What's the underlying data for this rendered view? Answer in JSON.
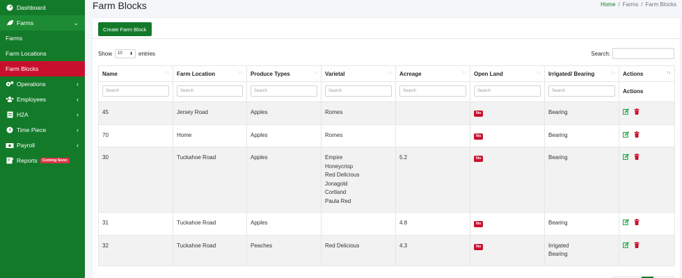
{
  "sidebar": {
    "items": [
      {
        "label": "Dashboard",
        "icon": "dashboard-icon"
      },
      {
        "label": "Farms",
        "icon": "leaf-icon"
      },
      {
        "label": "Farms"
      },
      {
        "label": "Farm Locations"
      },
      {
        "label": "Farm Blocks"
      },
      {
        "label": "Operations",
        "icon": "cogs-icon"
      },
      {
        "label": "Employees",
        "icon": "users-icon"
      },
      {
        "label": "H2A",
        "icon": "file-icon"
      },
      {
        "label": "Time Piece",
        "icon": "clock-icon"
      },
      {
        "label": "Payroll",
        "icon": "money-icon"
      },
      {
        "label": "Reports",
        "icon": "report-icon",
        "badge": "Coming Soon"
      }
    ]
  },
  "header": {
    "title": "Farm Blocks",
    "breadcrumb": [
      "Home",
      "/",
      "Farms",
      "/",
      "Farm Blocks"
    ]
  },
  "toolbar": {
    "create_label": "Create Farm Block"
  },
  "controls": {
    "show_label": "Show",
    "entries_value": "10",
    "entries_label": "entries",
    "search_label": "Search:"
  },
  "table": {
    "columns": [
      "Name",
      "Farm Location",
      "Produce Types",
      "Varietal",
      "Acreage",
      "Open Land",
      "Irrigated/ Bearing",
      "Actions"
    ],
    "filter_placeholder": "Search",
    "filter_actions_label": "Actions",
    "rows": [
      {
        "name": "45",
        "location": "Jersey Road",
        "produce": "Apples",
        "varietal": [
          "Romes"
        ],
        "acreage": "",
        "open_land": "No",
        "irrigated": [
          "Bearing"
        ]
      },
      {
        "name": "70",
        "location": "Home",
        "produce": "Apples",
        "varietal": [
          "Romes"
        ],
        "acreage": "",
        "open_land": "No",
        "irrigated": [
          "Bearing"
        ]
      },
      {
        "name": "30",
        "location": "Tuckahoe Road",
        "produce": "Apples",
        "varietal": [
          "Empire",
          "Honeycrisp",
          "Red Delicious",
          "Jonagold",
          "Cortland",
          "Paula Red"
        ],
        "acreage": "5.2",
        "open_land": "No",
        "irrigated": [
          "Bearing"
        ]
      },
      {
        "name": "31",
        "location": "Tuckahoe Road",
        "produce": "Apples",
        "varietal": [],
        "acreage": "4.8",
        "open_land": "No",
        "irrigated": [
          "Bearing"
        ]
      },
      {
        "name": "32",
        "location": "Tuckahoe Road",
        "produce": "Peaches",
        "varietal": [
          "Red Delicious"
        ],
        "acreage": "4.3",
        "open_land": "No",
        "irrigated": [
          "Irrigated",
          "Bearing"
        ]
      }
    ]
  },
  "colors": {
    "sidebar": "#137a2a",
    "active": "#c8102e",
    "badge_no": "#c8102e",
    "edit": "#28a745",
    "delete": "#c8102e"
  }
}
